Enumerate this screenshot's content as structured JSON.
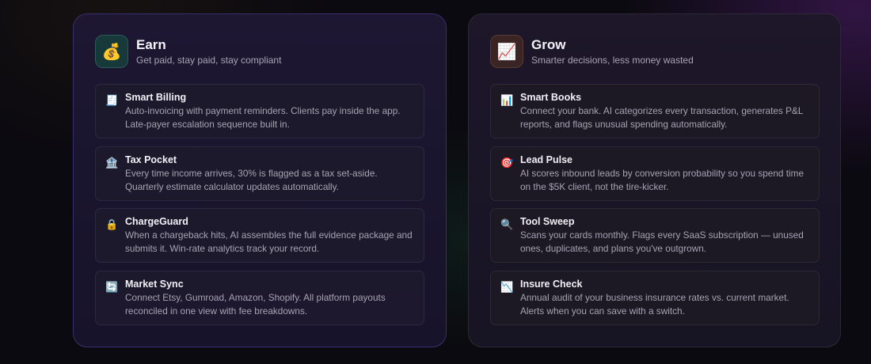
{
  "earn": {
    "icon": "money-bag-icon",
    "icon_glyph": "💰",
    "title": "Earn",
    "subtitle": "Get paid, stay paid, stay compliant",
    "features": [
      {
        "icon": "receipt-icon",
        "icon_glyph": "🧾",
        "title": "Smart Billing",
        "desc_1": "Auto-invoicing with payment reminders. Clients pay inside the app.",
        "desc_2": "Late-payer escalation sequence built in."
      },
      {
        "icon": "bank-icon",
        "icon_glyph": "🏦",
        "title": "Tax Pocket",
        "desc_1": "Every time income arrives, 30% is flagged as a tax set-aside.",
        "desc_2": "Quarterly estimate calculator updates automatically."
      },
      {
        "icon": "lock-icon",
        "icon_glyph": "🔒",
        "title": "ChargeGuard",
        "desc_1": "When a chargeback hits, AI assembles the full evidence package and",
        "desc_2": "submits it. Win-rate analytics track your record."
      },
      {
        "icon": "sync-icon",
        "icon_glyph": "🔄",
        "title": "Market Sync",
        "desc_1": "Connect Etsy, Gumroad, Amazon, Shopify. All platform payouts",
        "desc_2": "reconciled in one view with fee breakdowns."
      }
    ]
  },
  "grow": {
    "icon": "chart-up-icon",
    "icon_glyph": "📈",
    "title": "Grow",
    "subtitle": "Smarter decisions, less money wasted",
    "features": [
      {
        "icon": "bar-chart-icon",
        "icon_glyph": "📊",
        "title": "Smart Books",
        "desc_1": "Connect your bank. AI categorizes every transaction, generates P&L",
        "desc_2": "reports, and flags unusual spending automatically."
      },
      {
        "icon": "target-icon",
        "icon_glyph": "🎯",
        "title": "Lead Pulse",
        "desc_1": "AI scores inbound leads by conversion probability so you spend time",
        "desc_2": "on the $5K client, not the tire-kicker."
      },
      {
        "icon": "magnifier-icon",
        "icon_glyph": "🔍",
        "title": "Tool Sweep",
        "desc_1": "Scans your cards monthly. Flags every SaaS subscription — unused",
        "desc_2": "ones, duplicates, and plans you've outgrown."
      },
      {
        "icon": "chart-down-icon",
        "icon_glyph": "📉",
        "title": "Insure Check",
        "desc_1": "Annual audit of your business insurance rates vs. current market.",
        "desc_2": "Alerts when you can save with a switch."
      }
    ]
  }
}
